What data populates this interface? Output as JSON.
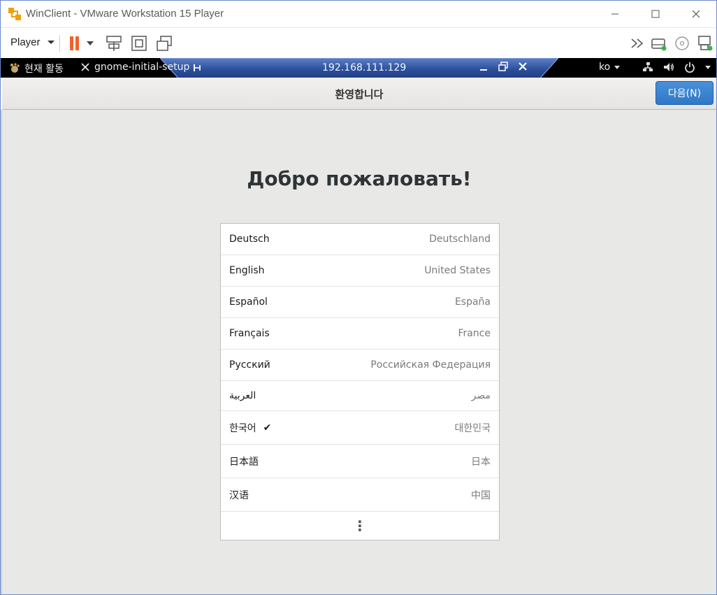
{
  "window": {
    "title": "WinClient - VMware Workstation 15 Player",
    "brand_color": "#f0a000"
  },
  "toolbar": {
    "player_label": "Player",
    "pause_color": "#f0622d"
  },
  "gnome_bar": {
    "activities": "현재 활동",
    "app_name": "gnome-initial-setup",
    "remote_ip": "192.168.111.129",
    "input_lang": "ko"
  },
  "header": {
    "title": "환영합니다",
    "next_label": "다음(N)"
  },
  "main": {
    "welcome": "Добро пожаловать!",
    "languages": [
      {
        "name": "Deutsch",
        "region": "Deutschland",
        "selected": false
      },
      {
        "name": "English",
        "region": "United States",
        "selected": false
      },
      {
        "name": "Español",
        "region": "España",
        "selected": false
      },
      {
        "name": "Français",
        "region": "France",
        "selected": false
      },
      {
        "name": "Русский",
        "region": "Российская Федерация",
        "selected": false
      },
      {
        "name": "العربية",
        "region": "مصر",
        "selected": false
      },
      {
        "name": "한국어",
        "region": "대한민국",
        "selected": true
      },
      {
        "name": "日本語",
        "region": "日本",
        "selected": false
      },
      {
        "name": "汉语",
        "region": "中国",
        "selected": false
      }
    ],
    "more_symbol": "⋮",
    "check_symbol": "✔"
  }
}
